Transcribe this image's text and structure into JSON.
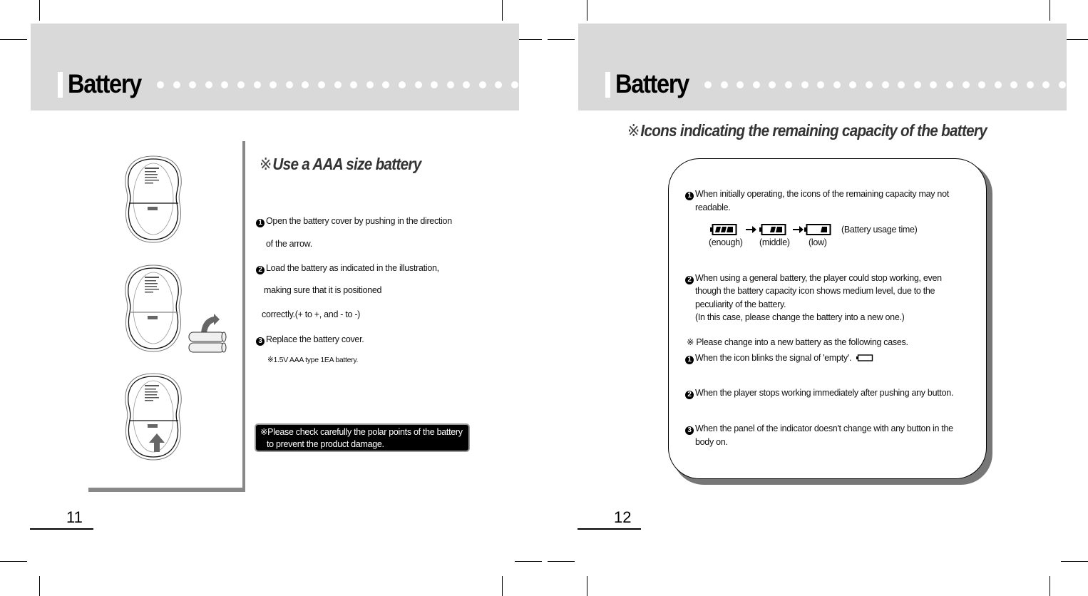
{
  "left_page": {
    "header": {
      "title": "Battery"
    },
    "page_number": "11",
    "section_heading": {
      "ref_mark": "※",
      "text": "Use a AAA size battery"
    },
    "steps": [
      {
        "marker": "1",
        "lines": [
          "Open the battery cover by pushing in the direction",
          "of the arrow."
        ]
      },
      {
        "marker": "2",
        "lines": [
          "Load the battery as indicated in the illustration,",
          "making sure that it is positioned",
          "correctly.(+ to +, and - to -)"
        ]
      },
      {
        "marker": "3",
        "lines": [
          "Replace the battery cover."
        ]
      }
    ],
    "note": "※1.5V AAA type 1EA battery.",
    "warning": {
      "line1": "※Please check carefully the polar points of the battery",
      "line2": "to prevent the product damage."
    },
    "illustrations": [
      "player-back-cover-open",
      "player-with-aaa-batteries",
      "player-cover-close-arrow"
    ]
  },
  "right_page": {
    "header": {
      "title": "Battery"
    },
    "page_number": "12",
    "section_heading": {
      "ref_mark": "※",
      "text": "Icons indicating the remaining capacity of the battery"
    },
    "panel": {
      "item1": {
        "marker": "1",
        "lines": [
          "When initially operating, the icons of the remaining capacity may not",
          "readable."
        ]
      },
      "battery_levels": [
        {
          "label": "(enough)",
          "level": 3
        },
        {
          "label": "(middle)",
          "level": 2
        },
        {
          "label": "(low)",
          "level": 1
        }
      ],
      "usage_caption": "(Battery usage time)",
      "item2": {
        "marker": "2",
        "lines": [
          "When using a general battery, the player could stop working, even",
          "though the battery capacity icon shows medium level, due to the",
          "peculiarity of the battery.",
          "(In this case, please change the battery into a new one.)"
        ]
      },
      "change_note": "※ Please change into a new battery as the following cases.",
      "cases": [
        {
          "marker": "1",
          "lines": [
            "When the icon blinks the signal of 'empty'."
          ],
          "icon": "empty-battery"
        },
        {
          "marker": "2",
          "lines": [
            "When the player stops working immediately after pushing any button."
          ]
        },
        {
          "marker": "3",
          "lines": [
            "When the panel of the indicator doesn't change with any button  in the",
            "body on."
          ]
        }
      ]
    }
  }
}
